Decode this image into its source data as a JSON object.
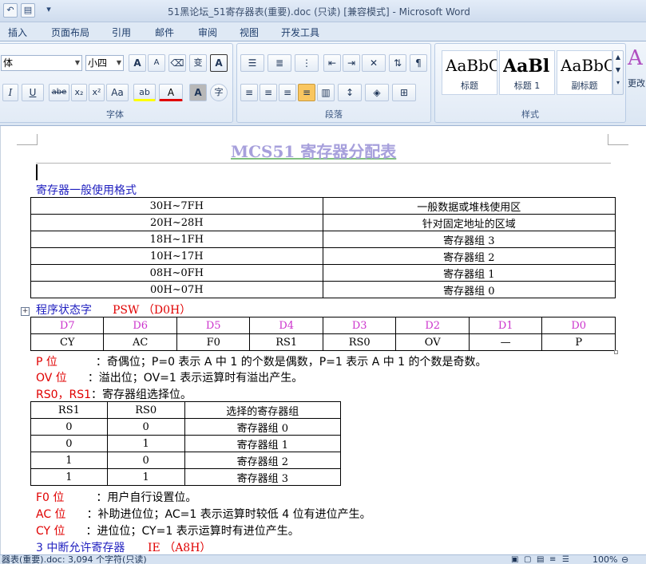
{
  "window": {
    "title": "51黑论坛_51寄存器表(重要).doc (只读) [兼容模式] - Microsoft Word"
  },
  "tabs": [
    "插入",
    "页面布局",
    "引用",
    "邮件",
    "审阅",
    "视图",
    "开发工具"
  ],
  "ribbon": {
    "font": {
      "name_value": "体",
      "size_value": "小四",
      "grow_label": "A",
      "shrink_label": "A",
      "phonetic_label": "变",
      "border_char_label": "A",
      "italic": "I",
      "underline": "U",
      "strike": "abe",
      "subscript": "x₂",
      "superscript": "x²",
      "change_case": "Aa",
      "highlight": "ab",
      "font_color": "A",
      "char_shading": "A",
      "enclose": "字",
      "group_label": "字体"
    },
    "paragraph": {
      "group_label": "段落"
    },
    "styles": {
      "group_label": "样式",
      "items": [
        {
          "sample": "AaBbC",
          "label": "标题"
        },
        {
          "sample": "AaBl",
          "label": "标题 1"
        },
        {
          "sample": "AaBbC",
          "label": "副标题"
        }
      ],
      "change_label": "更改"
    }
  },
  "document": {
    "heading": "MCS51 寄存器分配表",
    "section1_title": "寄存器一般使用格式",
    "table1": [
      [
        "30H~7FH",
        "一般数据或堆栈使用区"
      ],
      [
        "20H~28H",
        "针对固定地址的区域"
      ],
      [
        "18H~1FH",
        "寄存器组 3"
      ],
      [
        "10H~17H",
        "寄存器组 2"
      ],
      [
        "08H~0FH",
        "寄存器组 1"
      ],
      [
        "00H~07H",
        "寄存器组 0"
      ]
    ],
    "section2_title": "程序状态字",
    "section2_reg": "PSW （D0H）",
    "table2_bits": [
      "D7",
      "D6",
      "D5",
      "D4",
      "D3",
      "D2",
      "D1",
      "D0"
    ],
    "table2_names": [
      "CY",
      "AC",
      "F0",
      "RS1",
      "RS0",
      "OV",
      "—",
      "P"
    ],
    "p_label": "P 位",
    "p_desc": "：奇偶位；P=0 表示 A 中 1 的个数是偶数，P=1 表示 A 中 1 的个数是奇数。",
    "ov_label": "OV 位",
    "ov_desc": "：溢出位；OV=1 表示运算时有溢出产生。",
    "rs_label": "RS0，RS1",
    "rs_desc": "：寄存器组选择位。",
    "table3_header": [
      "RS1",
      "RS0",
      "选择的寄存器组"
    ],
    "table3": [
      [
        "0",
        "0",
        "寄存器组 0"
      ],
      [
        "0",
        "1",
        "寄存器组 1"
      ],
      [
        "1",
        "0",
        "寄存器组 2"
      ],
      [
        "1",
        "1",
        "寄存器组 3"
      ]
    ],
    "f0_label": "F0 位",
    "f0_desc": "：用户自行设置位。",
    "ac_label": "AC 位",
    "ac_desc": "：补助进位位；AC=1 表示运算时较低 4 位有进位产生。",
    "cy_label": "CY 位",
    "cy_desc": "：进位位；CY=1 表示运算时有进位产生。",
    "section3_title": "3 中断允许寄存器",
    "section3_reg": "IE （A8H）"
  },
  "statusbar": {
    "left": "器表(重要).doc: 3,094 个字符(只读)",
    "zoom": "100%"
  }
}
